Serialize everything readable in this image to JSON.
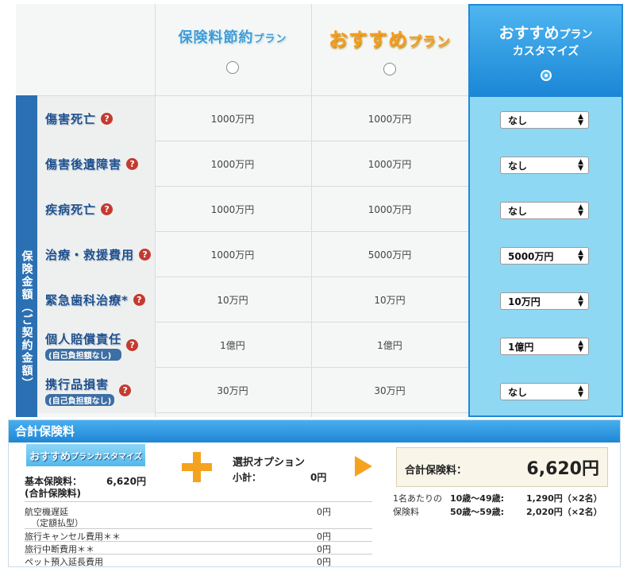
{
  "plans": {
    "saving": {
      "name": "保険料節約",
      "suffix": "プラン"
    },
    "recommended": {
      "name": "おすすめ",
      "suffix": "プラン"
    },
    "custom": {
      "name": "おすすめ",
      "suffix": "プラン",
      "sub": "カスタマイズ"
    }
  },
  "side_label": "保険金額（ご契約金額）",
  "rows": [
    {
      "label": "傷害死亡",
      "sub": "",
      "saving": "1000万円",
      "recommended": "1000万円",
      "custom": "なし"
    },
    {
      "label": "傷害後遺障害",
      "sub": "",
      "saving": "1000万円",
      "recommended": "1000万円",
      "custom": "なし"
    },
    {
      "label": "疾病死亡",
      "sub": "",
      "saving": "1000万円",
      "recommended": "1000万円",
      "custom": "なし"
    },
    {
      "label": "治療・救援費用",
      "sub": "",
      "saving": "1000万円",
      "recommended": "5000万円",
      "custom": "5000万円"
    },
    {
      "label": "緊急歯科治療*",
      "sub": "",
      "saving": "10万円",
      "recommended": "10万円",
      "custom": "10万円"
    },
    {
      "label": "個人賠償責任",
      "sub": "(自己負担額なし)",
      "saving": "1億円",
      "recommended": "1億円",
      "custom": "1億円"
    },
    {
      "label": "携行品損害",
      "sub": "(自己負担額なし)",
      "saving": "30万円",
      "recommended": "30万円",
      "custom": "なし"
    }
  ],
  "help_glyph": "?",
  "select_arrows": "▲▼",
  "summary": {
    "header": "合計保険料",
    "badge": {
      "main": "おすすめ",
      "small": "プランカスタマイズ"
    },
    "basic_label": "基本保険料：",
    "basic_value": "6,620円",
    "basic_note": "(合計保険料)",
    "option_title": "選択オプション",
    "subtotal_label": "小計：",
    "subtotal_value": "0円",
    "total_label": "合計保険料：",
    "total_value": "6,620円",
    "per_person_1": "1名あたりの",
    "per_person_2": "保険料",
    "ages": [
      {
        "range": "10歳〜49歳:",
        "price": "1,290円（×2名）"
      },
      {
        "range": "50歳〜59歳:",
        "price": "2,020円（×2名）"
      }
    ],
    "options": [
      {
        "label": "航空機遅延",
        "sub": "（定額払型）",
        "value": "0円"
      },
      {
        "label": "旅行キャンセル費用＊＊",
        "value": "0円"
      },
      {
        "label": "旅行中断費用＊＊",
        "value": "0円"
      },
      {
        "label": "ペット預入延長費用",
        "value": "0円"
      }
    ]
  },
  "colors": {
    "blue_header": "#1f86d3",
    "custom_bg": "#8fd8f3",
    "accent_orange": "#f5a31f",
    "side_blue": "#2a70b3"
  }
}
